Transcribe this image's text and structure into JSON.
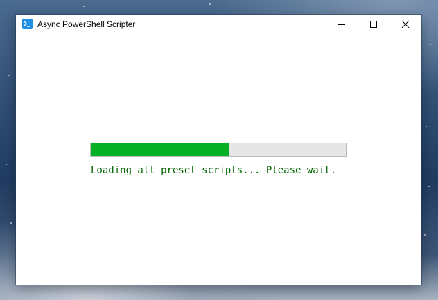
{
  "desktop": {
    "background": "night-sky-wallpaper"
  },
  "window": {
    "title": "Async PowerShell Scripter",
    "icon": "powershell-icon",
    "controls": {
      "minimize_icon": "minimize-icon",
      "maximize_icon": "maximize-icon",
      "close_icon": "close-icon"
    }
  },
  "content": {
    "progress": {
      "fraction": 0.54,
      "fill_color": "#06b025",
      "track_color": "#e6e6e6"
    },
    "status_text": "Loading all preset scripts... Please wait.",
    "status_color": "#006400"
  }
}
